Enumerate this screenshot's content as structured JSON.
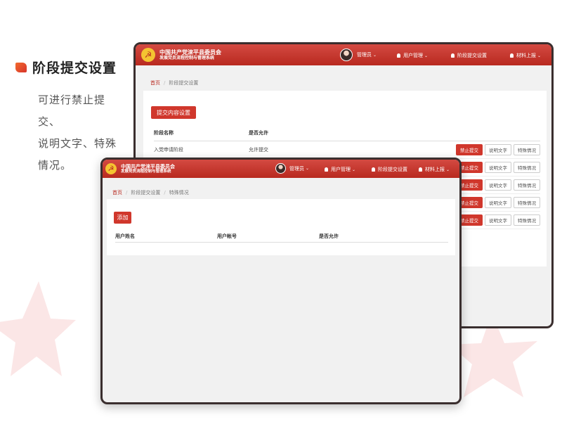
{
  "promo": {
    "title": "阶段提交设置",
    "desc_lines": [
      "可进行禁止提交、",
      "说明文字、特殊",
      "情况。"
    ]
  },
  "app": {
    "brand_line1": "中国共产党淶平县委员会",
    "brand_line2": "发展党员流程控制与管理系统",
    "nav": {
      "admin": "管理员",
      "user_mgmt": "用户管理",
      "stage_setting": "阶段提交设置",
      "material": "材料上报"
    }
  },
  "back_window": {
    "breadcrumb": {
      "home": "首页",
      "current": "阶段提交设置"
    },
    "add_button": "提交内容设置",
    "columns": [
      "阶段名称",
      "是否允许"
    ],
    "rows": [
      {
        "stage": "入党申请阶段",
        "allow": "允许提交"
      },
      {
        "stage": "",
        "allow": ""
      },
      {
        "stage": "",
        "allow": ""
      },
      {
        "stage": "",
        "allow": ""
      },
      {
        "stage": "",
        "allow": ""
      }
    ],
    "row_actions": {
      "forbid": "禁止提交",
      "explain": "说明文字",
      "special": "特殊情况"
    }
  },
  "front_window": {
    "breadcrumb": {
      "home": "首页",
      "mid": "阶段提交设置",
      "current": "特殊情况"
    },
    "add_button": "添加",
    "columns": [
      "用户姓名",
      "用户帐号",
      "是否允许"
    ]
  },
  "colors": {
    "primary_red": "#d0372c",
    "header_red_dark": "#b8291f",
    "emblem_gold": "#f4c431"
  }
}
